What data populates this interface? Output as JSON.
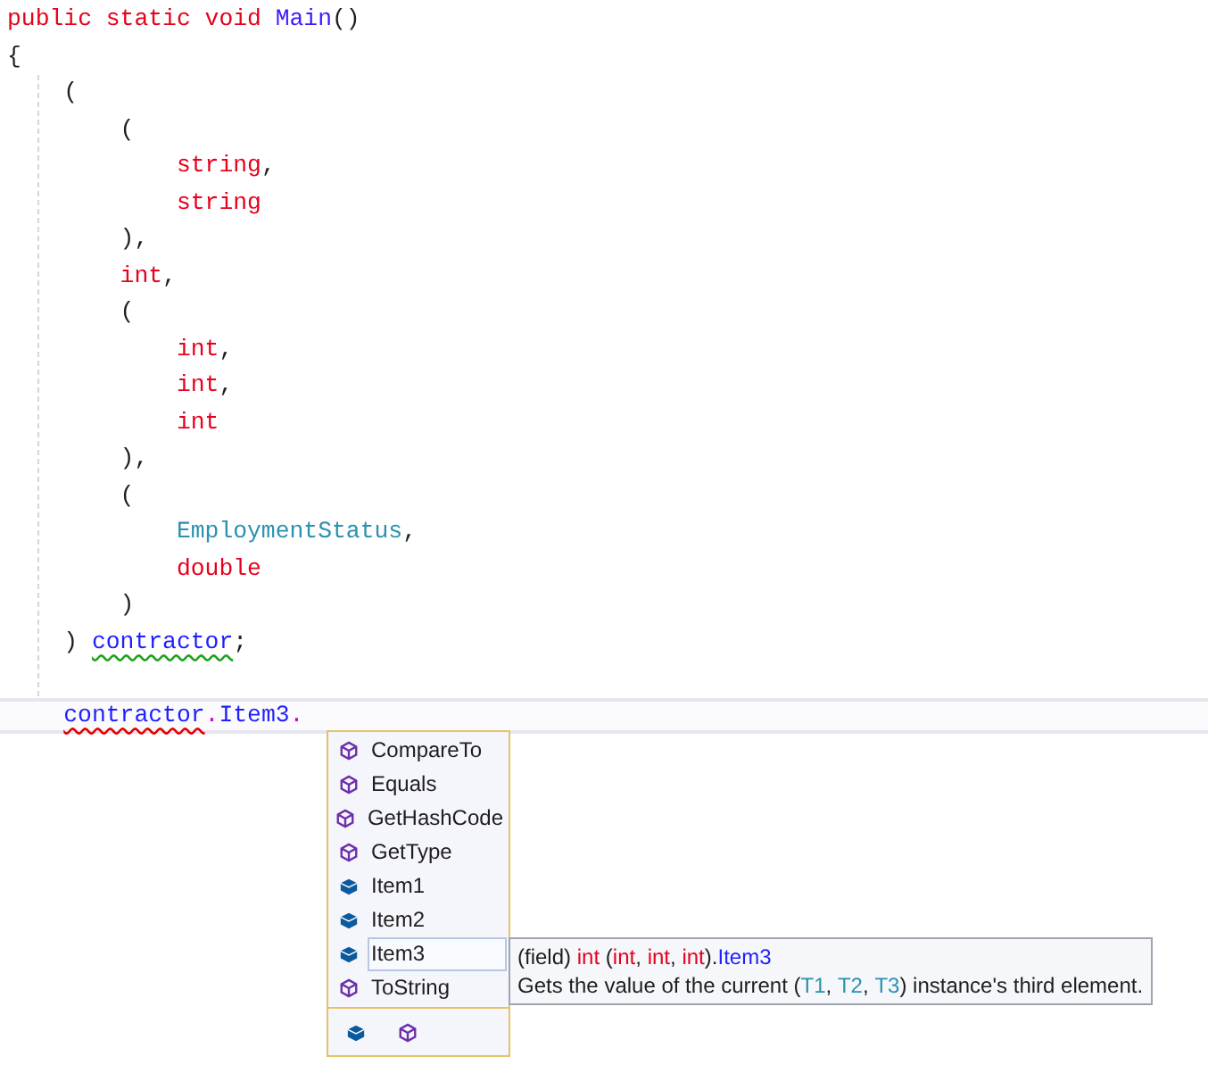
{
  "code_lines": [
    {
      "current": false,
      "tokens": [
        {
          "text": "public static void",
          "kind": "keyword"
        },
        {
          "text": "Main",
          "kind": "method"
        },
        {
          "text": "()",
          "kind": "punct"
        }
      ]
    },
    {
      "current": false,
      "tokens": [
        {
          "text": "{",
          "kind": "punct"
        }
      ]
    },
    {
      "current": false,
      "tokens": [
        {
          "text": "(",
          "kind": "punct"
        }
      ]
    },
    {
      "current": false,
      "tokens": [
        {
          "text": "(",
          "kind": "punct"
        }
      ]
    },
    {
      "current": false,
      "tokens": [
        {
          "text": "string",
          "kind": "keyword"
        },
        {
          "text": ",",
          "kind": "punct"
        }
      ]
    },
    {
      "current": false,
      "tokens": [
        {
          "text": "string",
          "kind": "keyword"
        }
      ]
    },
    {
      "current": false,
      "tokens": [
        {
          "text": "),",
          "kind": "punct"
        }
      ]
    },
    {
      "current": false,
      "tokens": [
        {
          "text": "int",
          "kind": "keyword"
        },
        {
          "text": ",",
          "kind": "punct"
        }
      ]
    },
    {
      "current": false,
      "tokens": [
        {
          "text": "(",
          "kind": "punct"
        }
      ]
    },
    {
      "current": false,
      "tokens": [
        {
          "text": "int",
          "kind": "keyword"
        },
        {
          "text": ",",
          "kind": "punct"
        }
      ]
    },
    {
      "current": false,
      "tokens": [
        {
          "text": "int",
          "kind": "keyword"
        },
        {
          "text": ",",
          "kind": "punct"
        }
      ]
    },
    {
      "current": false,
      "tokens": [
        {
          "text": "int",
          "kind": "keyword"
        }
      ]
    },
    {
      "current": false,
      "tokens": [
        {
          "text": "),",
          "kind": "punct"
        }
      ]
    },
    {
      "current": false,
      "tokens": [
        {
          "text": "(",
          "kind": "punct"
        }
      ]
    },
    {
      "current": false,
      "tokens": [
        {
          "text": "EmploymentStatus",
          "kind": "type"
        },
        {
          "text": ",",
          "kind": "punct"
        }
      ]
    },
    {
      "current": false,
      "tokens": [
        {
          "text": "double",
          "kind": "keyword"
        }
      ]
    },
    {
      "current": false,
      "tokens": [
        {
          "text": ")",
          "kind": "punct"
        }
      ]
    },
    {
      "current": false,
      "tokens": [
        {
          "text": ")",
          "kind": "punct"
        },
        {
          "text": "contractor",
          "kind": "identifier",
          "warning": true
        },
        {
          "text": ";",
          "kind": "punct"
        }
      ]
    },
    {
      "current": false
    },
    {
      "current": true,
      "tokens": [
        {
          "text": "contractor",
          "kind": "identifier",
          "error": true
        },
        {
          "text": ".",
          "kind": "member_dot"
        },
        {
          "text": "Item3",
          "kind": "identifier"
        },
        {
          "text": ".",
          "kind": "member_dot"
        }
      ]
    }
  ],
  "completion": {
    "items": [
      {
        "label": "CompareTo",
        "kind": "method",
        "selected": false
      },
      {
        "label": "Equals",
        "kind": "method",
        "selected": false
      },
      {
        "label": "GetHashCode",
        "kind": "method",
        "selected": false
      },
      {
        "label": "GetType",
        "kind": "method",
        "selected": false
      },
      {
        "label": "Item1",
        "kind": "field",
        "selected": false
      },
      {
        "label": "Item2",
        "kind": "field",
        "selected": false
      },
      {
        "label": "Item3",
        "kind": "field",
        "selected": true
      },
      {
        "label": "ToString",
        "kind": "method",
        "selected": false
      }
    ],
    "filters": [
      {
        "kind": "field"
      },
      {
        "kind": "method"
      }
    ]
  },
  "tooltip": {
    "signature_parts": [
      {
        "text": "(field)",
        "kind": "plain"
      },
      {
        "text": "int",
        "kind": "keyword"
      },
      {
        "text": "(",
        "kind": "plain"
      },
      {
        "text": "int",
        "kind": "keyword"
      },
      {
        "text": ",",
        "kind": "plain"
      },
      {
        "text": "int",
        "kind": "keyword"
      },
      {
        "text": ",",
        "kind": "plain"
      },
      {
        "text": "int",
        "kind": "keyword"
      },
      {
        "text": ").",
        "kind": "plain"
      },
      {
        "text": "Item3",
        "kind": "identifier"
      }
    ],
    "description_parts": [
      {
        "text": "Gets the value of the current (",
        "kind": "plain"
      },
      {
        "text": "T1",
        "kind": "type"
      },
      {
        "text": ",",
        "kind": "plain"
      },
      {
        "text": "T2",
        "kind": "type"
      },
      {
        "text": ",",
        "kind": "plain"
      },
      {
        "text": "T3",
        "kind": "type"
      },
      {
        "text": ") instance's third element.",
        "kind": "plain"
      }
    ]
  }
}
